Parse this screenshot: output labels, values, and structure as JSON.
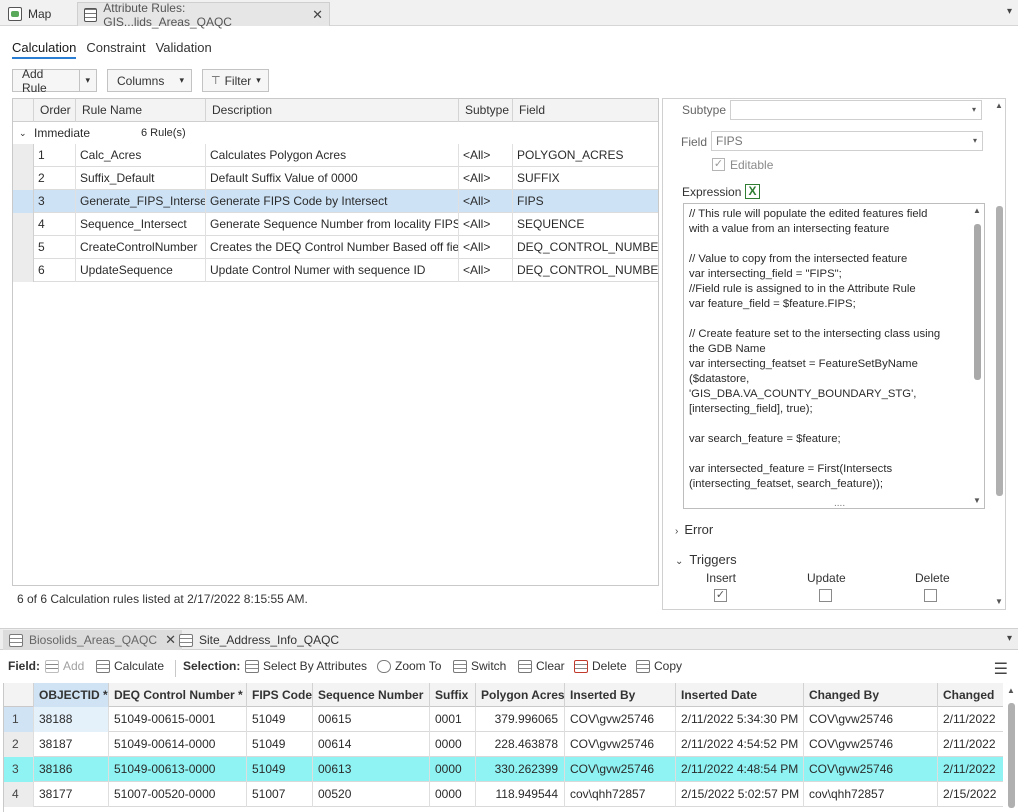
{
  "doc_tabs": {
    "map_label": "Map",
    "rules_label": "Attribute Rules: GIS...lids_Areas_QAQC",
    "close": "✕",
    "overflow": "▾"
  },
  "sub_tabs": [
    "Calculation",
    "Constraint",
    "Validation"
  ],
  "toolbar": {
    "add_rule": "Add Rule",
    "columns": "Columns",
    "filter": "Filter",
    "caret": "▾"
  },
  "rules_grid": {
    "headers": [
      "Order",
      "Rule Name",
      "Description",
      "Subtype",
      "Field"
    ],
    "group_name": "Immediate",
    "group_count": "6 Rule(s)",
    "group_caret": "⌄",
    "rows": [
      {
        "order": "1",
        "name": "Calc_Acres",
        "desc": "Calculates Polygon Acres",
        "subtype": "<All>",
        "field": "POLYGON_ACRES"
      },
      {
        "order": "2",
        "name": "Suffix_Default",
        "desc": "Default Suffix Value of 0000",
        "subtype": "<All>",
        "field": "SUFFIX"
      },
      {
        "order": "3",
        "name": "Generate_FIPS_Intersect",
        "desc": "Generate FIPS Code by Intersect",
        "subtype": "<All>",
        "field": "FIPS"
      },
      {
        "order": "4",
        "name": "Sequence_Intersect",
        "desc": "Generate Sequence Number from locality FIPS",
        "subtype": "<All>",
        "field": "SEQUENCE"
      },
      {
        "order": "5",
        "name": "CreateControlNumber",
        "desc": "Creates the DEQ Control Number Based off fiel",
        "subtype": "<All>",
        "field": "DEQ_CONTROL_NUMBER"
      },
      {
        "order": "6",
        "name": "UpdateSequence",
        "desc": "Update Control Numer with sequence ID",
        "subtype": "<All>",
        "field": "DEQ_CONTROL_NUMBER"
      }
    ],
    "status": "6 of 6 Calculation rules listed at 2/17/2022 8:15:55 AM."
  },
  "props": {
    "subtype_label": "Subtype",
    "subtype_value": "",
    "field_label": "Field",
    "field_value": "FIPS",
    "editable_label": "Editable",
    "expression_label": "Expression",
    "expression_icon": "X",
    "expression_lines": [
      "// This rule will populate the edited features field",
      "with a value from an intersecting feature",
      "",
      "// Value to copy from the intersected feature",
      "var intersecting_field = \"FIPS\";",
      "//Field rule is assigned to in the Attribute Rule",
      "var feature_field = $feature.FIPS;",
      "",
      "// Create feature set to the intersecting class using",
      "the GDB Name",
      "var intersecting_featset = FeatureSetByName",
      "($datastore,",
      "'GIS_DBA.VA_COUNTY_BOUNDARY_STG',",
      "[intersecting_field], true);",
      "",
      "var search_feature = $feature;",
      "",
      "var intersected_feature = First(Intersects",
      "(intersecting_featset, search_feature));"
    ],
    "code_more": "....",
    "error_label": "Error",
    "triggers_label": "Triggers",
    "trigger_insert": "Insert",
    "trigger_update": "Update",
    "trigger_delete": "Delete",
    "checkmark": "✓",
    "caret_right": "›",
    "caret_down": "⌄"
  },
  "lower_tabs": {
    "tab1": "Biosolids_Areas_QAQC",
    "tab2": "Site_Address_Info_QAQC"
  },
  "lower_toolbar": {
    "field_label": "Field:",
    "add": "Add",
    "calculate": "Calculate",
    "selection_label": "Selection:",
    "select_by_attributes": "Select By Attributes",
    "zoom_to": "Zoom To",
    "switch": "Switch",
    "clear": "Clear",
    "delete": "Delete",
    "copy": "Copy",
    "menu": "☰"
  },
  "attr_table": {
    "headers": [
      "OBJECTID *",
      "DEQ Control Number *",
      "FIPS Code",
      "Sequence Number",
      "Suffix",
      "Polygon Acres",
      "Inserted By",
      "Inserted Date",
      "Changed By",
      "Changed"
    ],
    "rows": [
      {
        "idx": "1",
        "oid": "38188",
        "ctrl": "51049-00615-0001",
        "fips": "51049",
        "seq": "00615",
        "suffix": "0001",
        "acres": "379.996065",
        "ins_by": "COV\\gvw25746",
        "ins_date": "2/11/2022 5:34:30 PM",
        "chg_by": "COV\\gvw25746",
        "chg": "2/11/2022"
      },
      {
        "idx": "2",
        "oid": "38187",
        "ctrl": "51049-00614-0000",
        "fips": "51049",
        "seq": "00614",
        "suffix": "0000",
        "acres": "228.463878",
        "ins_by": "COV\\gvw25746",
        "ins_date": "2/11/2022 4:54:52 PM",
        "chg_by": "COV\\gvw25746",
        "chg": "2/11/2022"
      },
      {
        "idx": "3",
        "oid": "38186",
        "ctrl": "51049-00613-0000",
        "fips": "51049",
        "seq": "00613",
        "suffix": "0000",
        "acres": "330.262399",
        "ins_by": "COV\\gvw25746",
        "ins_date": "2/11/2022 4:48:54 PM",
        "chg_by": "COV\\gvw25746",
        "chg": "2/11/2022"
      },
      {
        "idx": "4",
        "oid": "38177",
        "ctrl": "51007-00520-0000",
        "fips": "51007",
        "seq": "00520",
        "suffix": "0000",
        "acres": "118.949544",
        "ins_by": "cov\\qhh72857",
        "ins_date": "2/15/2022 5:02:57 PM",
        "chg_by": "cov\\qhh72857",
        "chg": "2/15/2022"
      }
    ]
  },
  "colors": {
    "accent": "#2a7fd4",
    "selected_row": "#cde2f5",
    "highlight_row": "#8ff3f3",
    "expression_icon": "#2e7d32"
  }
}
